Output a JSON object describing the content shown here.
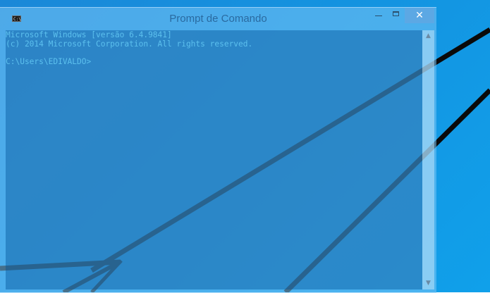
{
  "window": {
    "title": "Prompt de Comando",
    "icon": "cmd-console-icon",
    "icon_text": "C:\\",
    "controls": {
      "minimize": "minimize-icon",
      "maximize": "maximize-icon",
      "close_glyph": "✕"
    }
  },
  "console": {
    "lines": [
      "Microsoft Windows [versão 6.4.9841]",
      "(c) 2014 Microsoft Corporation. All rights reserved.",
      "C:\\Users\\EDIVALDO>"
    ]
  },
  "scrollbar": {
    "up_glyph": "▲",
    "down_glyph": "▼"
  },
  "colors": {
    "desktop": "#1493e0",
    "console_text": "#5cc0ee",
    "close_button": "#5ca8e4",
    "title_text": "#2a6aa0"
  }
}
